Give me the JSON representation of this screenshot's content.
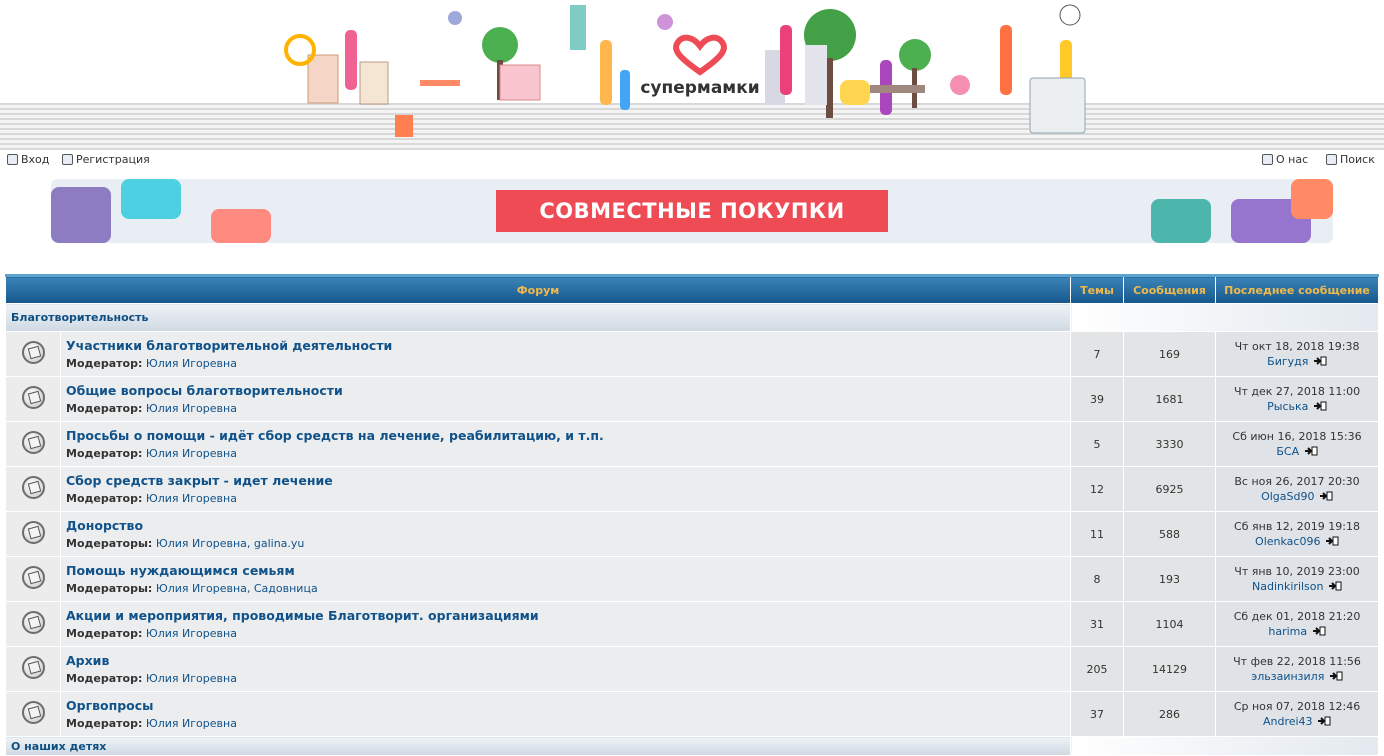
{
  "site": {
    "logo_text": "супермамки"
  },
  "topnav": {
    "login": "Вход",
    "register": "Регистрация",
    "about": "О нас",
    "search": "Поиск"
  },
  "banner": {
    "label": "СОВМЕСТНЫЕ ПОКУПКИ",
    "color": "#ef4b55"
  },
  "table": {
    "headers": {
      "forum": "Форум",
      "topics": "Темы",
      "posts": "Сообщения",
      "last": "Последнее сообщение"
    },
    "category": "Благотворительность",
    "next_category": "О наших детях",
    "rows": [
      {
        "name": "Участники благотворительной деятельности",
        "mod_label": "Модератор:",
        "mods": "Юлия Игоревна",
        "topics": "7",
        "posts": "169",
        "last_date": "Чт окт 18, 2018 19:38",
        "last_user": "Бигудя"
      },
      {
        "name": "Общие вопросы благотворительности",
        "mod_label": "Модератор:",
        "mods": "Юлия Игоревна",
        "topics": "39",
        "posts": "1681",
        "last_date": "Чт дек 27, 2018 11:00",
        "last_user": "Рыська"
      },
      {
        "name": "Просьбы о помощи - идёт сбор средств на лечение, реабилитацию, и т.п.",
        "mod_label": "Модератор:",
        "mods": "Юлия Игоревна",
        "topics": "5",
        "posts": "3330",
        "last_date": "Сб июн 16, 2018 15:36",
        "last_user": "БСА"
      },
      {
        "name": "Сбор средств закрыт - идет лечение",
        "mod_label": "Модератор:",
        "mods": "Юлия Игоревна",
        "topics": "12",
        "posts": "6925",
        "last_date": "Вс ноя 26, 2017 20:30",
        "last_user": "OlgaSd90"
      },
      {
        "name": "Донорство",
        "mod_label": "Модераторы:",
        "mods": "Юлия Игоревна, galina.yu",
        "topics": "11",
        "posts": "588",
        "last_date": "Сб янв 12, 2019 19:18",
        "last_user": "Olenkac096"
      },
      {
        "name": "Помощь нуждающимся семьям",
        "mod_label": "Модераторы:",
        "mods": "Юлия Игоревна, Садовница",
        "topics": "8",
        "posts": "193",
        "last_date": "Чт янв 10, 2019 23:00",
        "last_user": "Nadinkirilson"
      },
      {
        "name": "Акции и мероприятия, проводимые Благотворит. организациями",
        "mod_label": "Модератор:",
        "mods": "Юлия Игоревна",
        "topics": "31",
        "posts": "1104",
        "last_date": "Сб дек 01, 2018 21:20",
        "last_user": "harima"
      },
      {
        "name": "Архив",
        "mod_label": "Модератор:",
        "mods": "Юлия Игоревна",
        "topics": "205",
        "posts": "14129",
        "last_date": "Чт фев 22, 2018 11:56",
        "last_user": "эльзаинзиля"
      },
      {
        "name": "Оргвопросы",
        "mod_label": "Модератор:",
        "mods": "Юлия Игоревна",
        "topics": "37",
        "posts": "286",
        "last_date": "Ср ноя 07, 2018 12:46",
        "last_user": "Andrei43"
      }
    ]
  }
}
